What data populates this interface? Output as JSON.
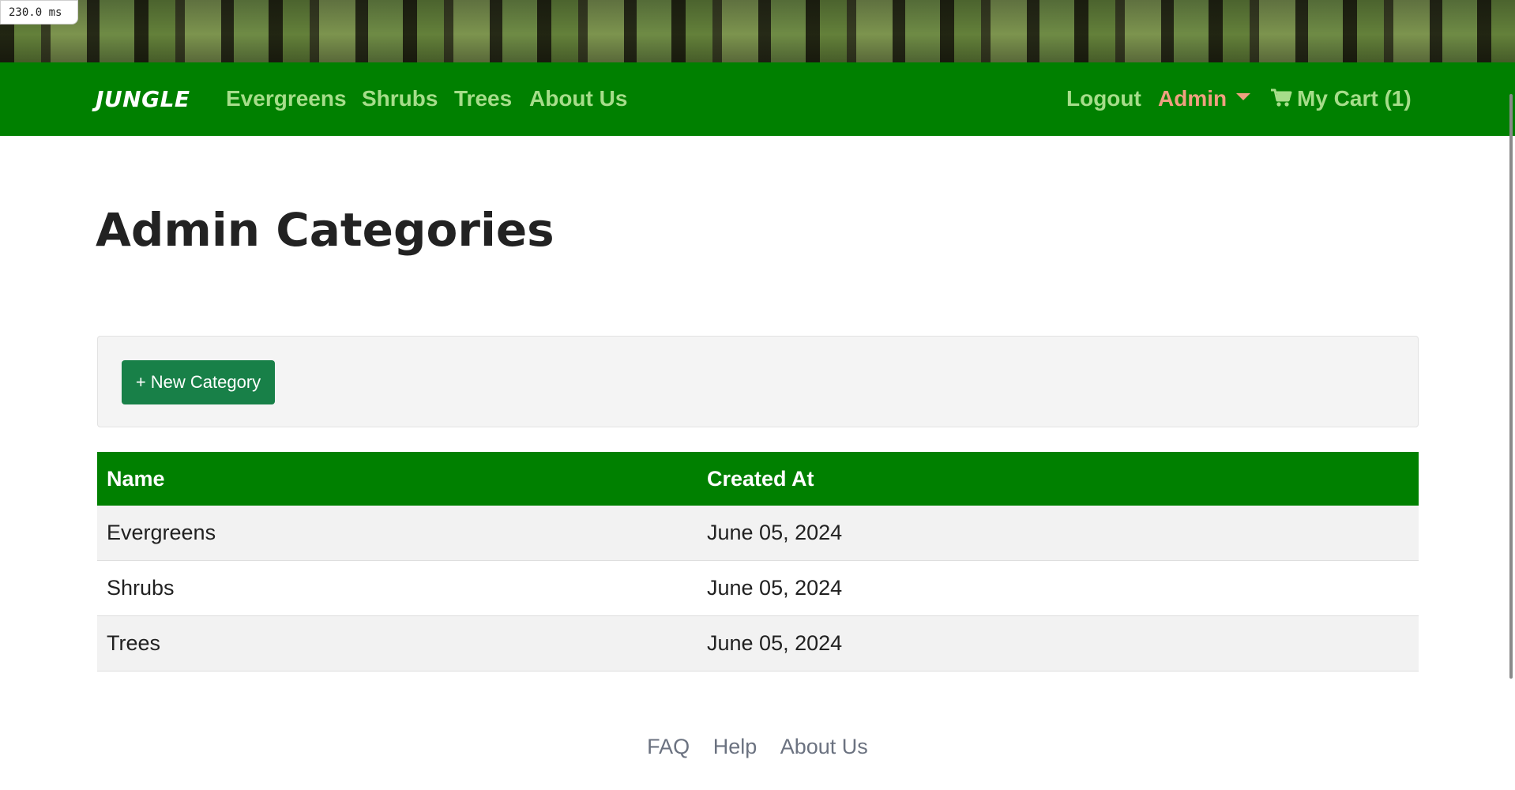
{
  "debug": {
    "render_time": "230.0 ms"
  },
  "navbar": {
    "brand": "JUNGLE",
    "links": [
      {
        "label": "Evergreens"
      },
      {
        "label": "Shrubs"
      },
      {
        "label": "Trees"
      },
      {
        "label": "About Us"
      }
    ],
    "logout": "Logout",
    "admin": "Admin",
    "cart": "My Cart (1)",
    "colors": {
      "background": "#008000",
      "link": "#a6dd8a",
      "admin": "#f0a080"
    }
  },
  "page": {
    "title": "Admin Categories",
    "new_button": "+ New Category"
  },
  "table": {
    "headers": [
      "Name",
      "Created At"
    ],
    "rows": [
      {
        "name": "Evergreens",
        "created_at": "June 05, 2024"
      },
      {
        "name": "Shrubs",
        "created_at": "June 05, 2024"
      },
      {
        "name": "Trees",
        "created_at": "June 05, 2024"
      }
    ]
  },
  "footer": {
    "links": [
      "FAQ",
      "Help",
      "About Us"
    ]
  }
}
